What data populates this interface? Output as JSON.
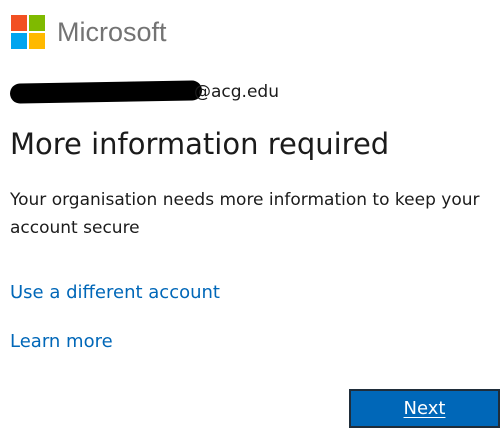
{
  "brand": {
    "name": "Microsoft",
    "logo_icon": "microsoft-four-squares-logo",
    "logo_colors": [
      "#f25022",
      "#7fba00",
      "#00a4ef",
      "#ffb900"
    ]
  },
  "identity": {
    "email_visible": "@acg.edu"
  },
  "content": {
    "title": "More information required",
    "description": "Your organisation needs more information to keep your account secure"
  },
  "links": {
    "different_account": "Use a different account",
    "learn_more": "Learn more"
  },
  "actions": {
    "next_label": "Next"
  },
  "colors": {
    "accent": "#0067b8",
    "text": "#1b1b1b",
    "logo_text": "#737373"
  }
}
